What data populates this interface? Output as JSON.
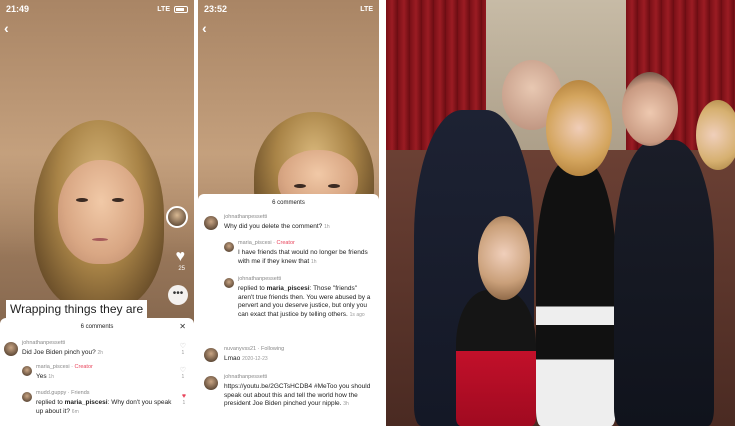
{
  "phone1": {
    "status": {
      "time": "21:49",
      "network": "LTE"
    },
    "caption": "Wrapping things they are",
    "side": {
      "likes": "25"
    },
    "comments": {
      "header": "6 comments",
      "items": [
        {
          "user": "johnathanpessetti",
          "text": "Did Joe Biden pinch you?",
          "meta": "2h",
          "likes": "1"
        },
        {
          "user": "maria_piscesi",
          "badge": "Creator",
          "text": "Yes",
          "meta": "1h",
          "likes": "1"
        },
        {
          "user": "mudd.guppy",
          "badge": "Friends",
          "text_prefix": "replied to",
          "mention": "maria_piscesi",
          "text": ": Why don't you speak up about it?",
          "meta": "6m",
          "likes": "1"
        }
      ]
    }
  },
  "phone2": {
    "status": {
      "time": "23:52",
      "network": "LTE"
    },
    "comments": {
      "header": "6 comments",
      "items": [
        {
          "user": "johnathanpessetti",
          "text": "Why did you delete the comment?",
          "meta": "1h"
        },
        {
          "user": "maria_piscesi",
          "badge": "Creator",
          "text": "I have friends that would no longer be friends with me if they knew that",
          "meta": "1h"
        },
        {
          "user": "johnathanpessetti",
          "text_prefix": "replied to",
          "mention": "maria_piscesi",
          "text": ": Those \"friends\" aren't true friends then. You were abused by a pervert and you deserve justice, but only you can exact that justice by telling others.",
          "meta": "1s ago"
        },
        {
          "user": "nuvanyvss21",
          "badge": "Following",
          "text": "Lmao",
          "meta": "2020-12-23"
        },
        {
          "user": "johnathanpessetti",
          "text": "https://youtu.be/2GCTsHCDB4 #MeToo you should speak out about this and tell the world how the president Joe Biden pinched your nipple.",
          "meta": "3h"
        }
      ]
    }
  },
  "colors": {
    "creator": "#e8455c",
    "curtain": "#9b1c23"
  }
}
